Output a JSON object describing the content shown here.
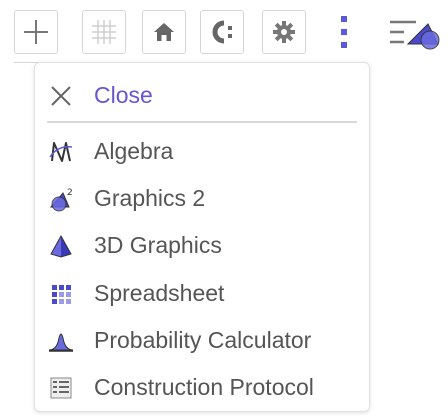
{
  "toolbar": {
    "buttons": [
      {
        "icon": "axes-icon"
      },
      {
        "icon": "grid-icon"
      },
      {
        "icon": "home-icon"
      },
      {
        "icon": "label-style-icon"
      },
      {
        "icon": "gear-icon"
      }
    ],
    "more_icon": "kebab-menu-icon",
    "perspective_icon": "perspectives-icon"
  },
  "menu": {
    "close_label": "Close",
    "items": [
      {
        "label": "Algebra",
        "icon": "algebra-icon"
      },
      {
        "label": "Graphics 2",
        "icon": "graphics2-icon"
      },
      {
        "label": "3D Graphics",
        "icon": "graphics3d-icon"
      },
      {
        "label": "Spreadsheet",
        "icon": "spreadsheet-icon"
      },
      {
        "label": "Probability Calculator",
        "icon": "probability-icon"
      },
      {
        "label": "Construction Protocol",
        "icon": "construction-protocol-icon"
      }
    ]
  },
  "colors": {
    "accent": "#6557d2",
    "text": "#555555",
    "icon_blue": "#4a4acb"
  }
}
